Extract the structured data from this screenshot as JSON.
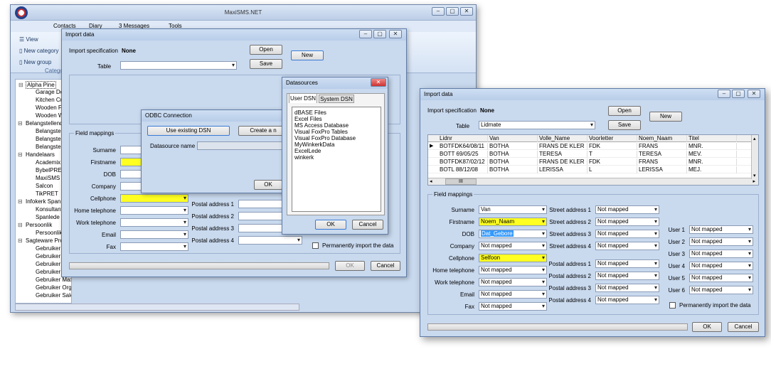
{
  "main_window": {
    "title": "MaxiSMS.NET",
    "tabs": [
      "Contacts",
      "Diary",
      "3 Messages",
      "Tools"
    ],
    "ribbon": {
      "view": "View",
      "new_category": "New category",
      "new_group": "New group",
      "category_caption": "Catego"
    },
    "tree": [
      {
        "label": "Alpha Pine",
        "level": 0
      },
      {
        "label": "Garage Do",
        "level": 1
      },
      {
        "label": "Kitchen Cu",
        "level": 1
      },
      {
        "label": "Wooden Fl",
        "level": 1
      },
      {
        "label": "Wooden W",
        "level": 1
      },
      {
        "label": "Belangstellend",
        "level": 0
      },
      {
        "label": "Belangstel",
        "level": 1
      },
      {
        "label": "Belangstel",
        "level": 1
      },
      {
        "label": "Belangstel",
        "level": 1
      },
      {
        "label": "Handelaars",
        "level": 0
      },
      {
        "label": "Academix",
        "level": 1
      },
      {
        "label": "BybelPRET",
        "level": 1
      },
      {
        "label": "MaxiSMS",
        "level": 1
      },
      {
        "label": "Salcon",
        "level": 1
      },
      {
        "label": "TikPRET",
        "level": 1
      },
      {
        "label": "Infokerk Span",
        "level": 0
      },
      {
        "label": "Konsultant",
        "level": 1
      },
      {
        "label": "Spanlede",
        "level": 1
      },
      {
        "label": "Persoonlik",
        "level": 0
      },
      {
        "label": "Persoonlik",
        "level": 1
      },
      {
        "label": "Sagteware Prod",
        "level": 0
      },
      {
        "label": "Gebruiker A",
        "level": 1
      },
      {
        "label": "Gebruiker B",
        "level": 1
      },
      {
        "label": "Gebruiker B",
        "level": 1
      },
      {
        "label": "Gebruiker M",
        "level": 1
      },
      {
        "label": "Gebruiker MaxiSMS SMS",
        "level": 1
      },
      {
        "label": "Gebruiker Organoniser",
        "level": 1
      },
      {
        "label": "Gebruiker Salcon",
        "level": 1
      }
    ]
  },
  "back_dialog": {
    "title": "Import data",
    "import_spec_label": "Import specification",
    "import_spec_value": "None",
    "open_label": "Open",
    "new_label": "New",
    "table_label": "Table",
    "save_label": "Save",
    "field_mappings_label": "Field mappings",
    "left_fields": [
      "Surname",
      "Firstname",
      "DOB",
      "Company",
      "Cellphone",
      "Home telephone",
      "Work telephone",
      "Email",
      "Fax"
    ],
    "postal_fields": [
      "Postal address 1",
      "Postal address 2",
      "Postal address 3",
      "Postal address 4"
    ],
    "permanent_label": "Permanently import the data",
    "ok_label": "OK",
    "cancel_label": "Cancel"
  },
  "odbc_dialog": {
    "title": "ODBC Connection",
    "use_existing_label": "Use existing DSN",
    "create_label": "Create a n",
    "dsn_label": "Datasource name",
    "ok_label": "OK"
  },
  "datasources_dialog": {
    "title": "Datasources",
    "tab_user": "User DSN",
    "tab_system": "System DSN",
    "items": [
      "dBASE Files",
      "Excel Files",
      "MS Access Database",
      "Visual FoxPro Tables",
      "Visual FoxPro Database",
      "MyWinkerkData",
      "ExcelLede",
      "winkerk"
    ],
    "ok_label": "OK",
    "cancel_label": "Cancel"
  },
  "front_dialog": {
    "title": "Import data",
    "import_spec_label": "Import specification",
    "import_spec_value": "None",
    "open_label": "Open",
    "new_label": "New",
    "table_label": "Table",
    "table_value": "Lidmate",
    "save_label": "Save",
    "grid": {
      "columns": [
        "Lidnr",
        "Van",
        "Volle_Name",
        "Voorletter",
        "Noem_Naam",
        "Titel"
      ],
      "rows": [
        [
          "BOTFDK64/08/11",
          "BOTHA",
          "FRANS DE KLER",
          "FDK",
          "FRANS",
          "MNR."
        ],
        [
          "BOTT  69/05/25",
          "BOTHA",
          "TERESA",
          "T",
          "TERESA",
          "MEV."
        ],
        [
          "BOTFDK87/02/12",
          "BOTHA",
          "FRANS DE KLER",
          "FDK",
          "FRANS",
          "MNR."
        ],
        [
          "BOTL  88/12/08",
          "BOTHA",
          "LERISSA",
          "L",
          "LERISSA",
          "MEJ."
        ]
      ],
      "scroll_glyph": "III"
    },
    "field_mappings_label": "Field mappings",
    "left_fields": [
      {
        "label": "Surname",
        "value": "Van"
      },
      {
        "label": "Firstname",
        "value": "Noem_Naam"
      },
      {
        "label": "DOB",
        "value": "Dat_Gebore"
      },
      {
        "label": "Company",
        "value": "Not mapped"
      },
      {
        "label": "Cellphone",
        "value": "Selfoon"
      },
      {
        "label": "Home telephone",
        "value": "Not mapped"
      },
      {
        "label": "Work telephone",
        "value": "Not mapped"
      },
      {
        "label": "Email",
        "value": "Not mapped"
      },
      {
        "label": "Fax",
        "value": "Not mapped"
      }
    ],
    "street_fields": [
      {
        "label": "Street address 1",
        "value": "Not mapped"
      },
      {
        "label": "Street address 2",
        "value": "Not mapped"
      },
      {
        "label": "Street address 3",
        "value": "Not mapped"
      },
      {
        "label": "Street address 4",
        "value": "Not mapped"
      }
    ],
    "postal_fields": [
      {
        "label": "Postal address 1",
        "value": "Not mapped"
      },
      {
        "label": "Postal address 2",
        "value": "Not mapped"
      },
      {
        "label": "Postal address 3",
        "value": "Not mapped"
      },
      {
        "label": "Postal address 4",
        "value": "Not mapped"
      }
    ],
    "user_fields": [
      {
        "label": "User 1",
        "value": "Not mapped"
      },
      {
        "label": "User 2",
        "value": "Not mapped"
      },
      {
        "label": "User 3",
        "value": "Not mapped"
      },
      {
        "label": "User 4",
        "value": "Not mapped"
      },
      {
        "label": "User 5",
        "value": "Not mapped"
      },
      {
        "label": "User 6",
        "value": "Not mapped"
      }
    ],
    "permanent_label": "Permanently import the data",
    "ok_label": "OK",
    "cancel_label": "Cancel"
  },
  "colors": {
    "highlight_yellow": "#ffff22",
    "selection_blue": "#3399ff",
    "window_bg": "#c9d9ee"
  }
}
